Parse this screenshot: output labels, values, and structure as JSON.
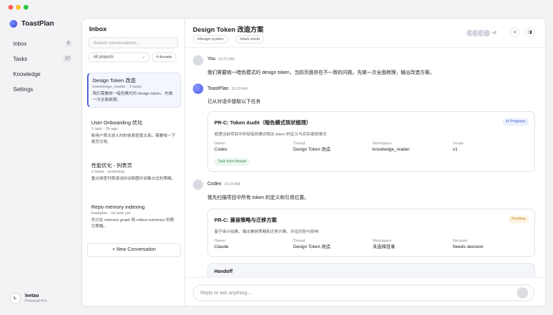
{
  "app": {
    "name": "ToastPlan"
  },
  "sidebar": {
    "items": [
      {
        "label": "Inbox",
        "badge": "8"
      },
      {
        "label": "Tasks",
        "badge": "17"
      },
      {
        "label": "Knowledge"
      },
      {
        "label": "Settings"
      }
    ],
    "user": {
      "initial": "L",
      "name": "leetao",
      "plan": "Personal Pro"
    }
  },
  "inbox": {
    "title": "Inbox",
    "search_placeholder": "Search conversations...",
    "filter_value": "All projects",
    "thread_count": "4 threads",
    "threads": [
      {
        "title": "Design Token 改造",
        "meta": "knowledge_reader · 3 tasks",
        "preview": "我们需要统一暗色模式的 design token，先做一次全面梳理。"
      },
      {
        "title": "User Onboarding 优化",
        "meta": "1 task · 2h ago",
        "preview": "新用户首次进入时的信息密度太高，需要收一下首页引导。"
      },
      {
        "title": "性能优化 - 列表页",
        "meta": "2 tasks · yesterday",
        "preview": "重点排查列表滚动抖动和图片加载占位的策略。"
      },
      {
        "title": "Repo memory indexing",
        "meta": "toastplan · no task yet",
        "preview": "先讨论 memory graph 和 rollout summary 的索引策略。"
      }
    ],
    "new_conversation": "+ New Conversation"
  },
  "main": {
    "title": "Design Token 改造方案",
    "tags": [
      "#design-system",
      "#dark-mode"
    ],
    "participants_more": "+2",
    "messages": [
      {
        "sender": "You",
        "time": "10:21 AM",
        "text": "我们需要统一暗色模式的 design token，当前页面存在不一致的问题。先做一次全面梳理，输出改造方案。"
      },
      {
        "sender": "ToastPlan",
        "time": "10:23 AM",
        "text": "已从对话中提取以下任务"
      },
      {
        "sender": "Codex",
        "time": "10:24 AM",
        "text": "我先扫描项目中所有 token 的定义和引用位置。"
      }
    ],
    "cards": [
      {
        "title": "PR-C: Token Audit（暗色模式现状梳理）",
        "status": "In Progress",
        "desc": "梳理当前项目中所有暗色模式相关 token 的定义与实际使用情况",
        "fields": [
          {
            "label": "Owner",
            "value": "Codex"
          },
          {
            "label": "Thread",
            "value": "Design Token 改造"
          },
          {
            "label": "Workspace",
            "value": "knowledge_reader"
          },
          {
            "label": "Scope",
            "value": "v1"
          }
        ],
        "chip": "Task from thread"
      },
      {
        "title": "PR-C: 兼容策略与迁移方案",
        "status": "Pending",
        "desc": "基于审计结果，输出兼容策略和迁移方案，评估风险与影响",
        "fields": [
          {
            "label": "Owner",
            "value": "Claude"
          },
          {
            "label": "Thread",
            "value": "Design Token 改造"
          },
          {
            "label": "Workspace",
            "value": "未选择目录"
          },
          {
            "label": "Decision",
            "value": "Needs decision"
          }
        ]
      }
    ],
    "handoff": "Handoff",
    "composer_placeholder": "Reply or ask anything..."
  },
  "icons": {
    "header_buttons": [
      "more-icon",
      "panel-toggle-icon"
    ]
  },
  "colors": {
    "accent": "#4a5fe0",
    "in_progress": "#3d5bd6",
    "pending": "#c07f16",
    "success": "#2f8b4d"
  }
}
